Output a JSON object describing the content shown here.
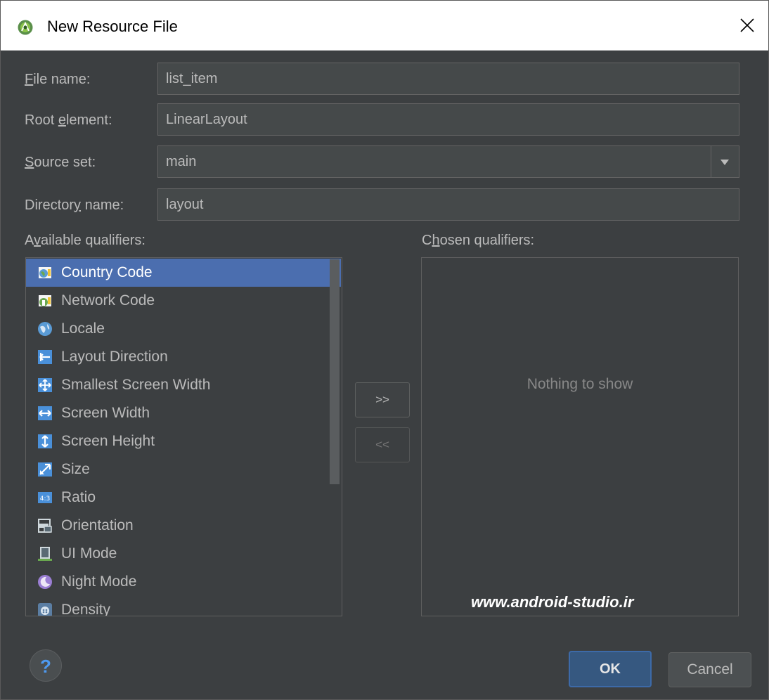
{
  "window": {
    "title": "New Resource File",
    "close_glyph": "✕"
  },
  "form": {
    "file_name": {
      "label_pre": "",
      "label_mnemonic": "F",
      "label_post": "ile name:",
      "value": "list_item"
    },
    "root_element": {
      "label_pre": "Root ",
      "label_mnemonic": "e",
      "label_post": "lement:",
      "value": "LinearLayout"
    },
    "source_set": {
      "label_pre": "",
      "label_mnemonic": "S",
      "label_post": "ource set:",
      "value": "main"
    },
    "directory_name": {
      "label_pre": "Director",
      "label_mnemonic": "y",
      "label_post": " name:",
      "value": "layout"
    }
  },
  "available": {
    "label_pre": "A",
    "label_mnemonic": "v",
    "label_post": "ailable qualifiers:",
    "items": [
      {
        "label": "Country Code",
        "icon": "country-code-icon",
        "selected": true
      },
      {
        "label": "Network Code",
        "icon": "network-code-icon"
      },
      {
        "label": "Locale",
        "icon": "globe-icon"
      },
      {
        "label": "Layout Direction",
        "icon": "layout-direction-icon"
      },
      {
        "label": "Smallest Screen Width",
        "icon": "smallest-width-icon"
      },
      {
        "label": "Screen Width",
        "icon": "screen-width-icon"
      },
      {
        "label": "Screen Height",
        "icon": "screen-height-icon"
      },
      {
        "label": "Size",
        "icon": "size-icon"
      },
      {
        "label": "Ratio",
        "icon": "ratio-icon"
      },
      {
        "label": "Orientation",
        "icon": "orientation-icon"
      },
      {
        "label": "UI Mode",
        "icon": "ui-mode-icon"
      },
      {
        "label": "Night Mode",
        "icon": "night-mode-icon"
      },
      {
        "label": "Density",
        "icon": "density-icon"
      }
    ]
  },
  "chosen": {
    "label_pre": "C",
    "label_mnemonic": "h",
    "label_post": "osen qualifiers:",
    "empty_text": "Nothing to show",
    "watermark": "www.android-studio.ir"
  },
  "buttons": {
    "add": ">>",
    "remove": "<<",
    "help": "?",
    "ok": "OK",
    "cancel": "Cancel"
  },
  "colors": {
    "background": "#3c3f41",
    "selection": "#4b6eaf",
    "ok_button": "#365880"
  }
}
